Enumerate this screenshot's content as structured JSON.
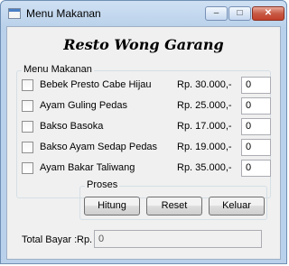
{
  "window": {
    "title": "Menu Makanan",
    "minimize_symbol": "–",
    "maximize_symbol": "□",
    "close_symbol": "✕"
  },
  "heading": "Resto Wong Garang",
  "menu_group": {
    "label": "Menu Makanan",
    "items": [
      {
        "name": "Bebek Presto Cabe Hijau",
        "price": "Rp. 30.000,-",
        "qty": "0",
        "checked": false
      },
      {
        "name": "Ayam Guling Pedas",
        "price": "Rp. 25.000,-",
        "qty": "0",
        "checked": false
      },
      {
        "name": "Bakso Basoka",
        "price": "Rp. 17.000,-",
        "qty": "0",
        "checked": false
      },
      {
        "name": "Bakso Ayam Sedap Pedas",
        "price": "Rp. 19.000,-",
        "qty": "0",
        "checked": false
      },
      {
        "name": "Ayam Bakar Taliwang",
        "price": "Rp. 35.000,-",
        "qty": "0",
        "checked": false
      }
    ]
  },
  "proses_group": {
    "label": "Proses",
    "hitung": "Hitung",
    "reset": "Reset",
    "keluar": "Keluar"
  },
  "total": {
    "label": "Total Bayar :",
    "currency": "Rp.",
    "value": "0"
  },
  "colors": {
    "titlebar": "#b9d1ea",
    "client_bg": "#f0f0f0",
    "close_button": "#c75a45"
  }
}
